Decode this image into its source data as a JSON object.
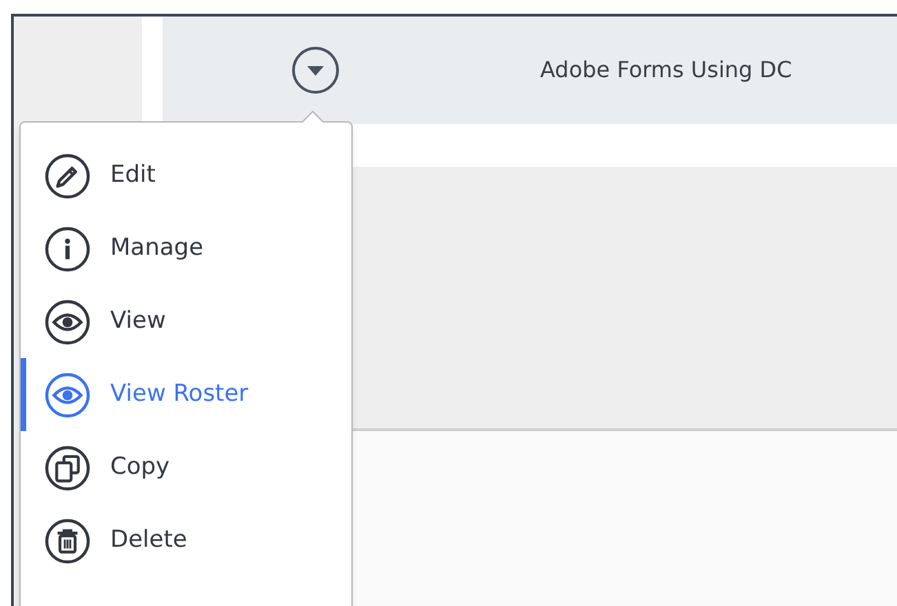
{
  "header": {
    "title": "Adobe Forms Using DC"
  },
  "menu": {
    "items": [
      {
        "label": "Edit",
        "selected": false
      },
      {
        "label": "Manage",
        "selected": false
      },
      {
        "label": "View",
        "selected": false
      },
      {
        "label": "View Roster",
        "selected": true
      },
      {
        "label": "Copy",
        "selected": false
      },
      {
        "label": "Delete",
        "selected": false
      }
    ]
  }
}
